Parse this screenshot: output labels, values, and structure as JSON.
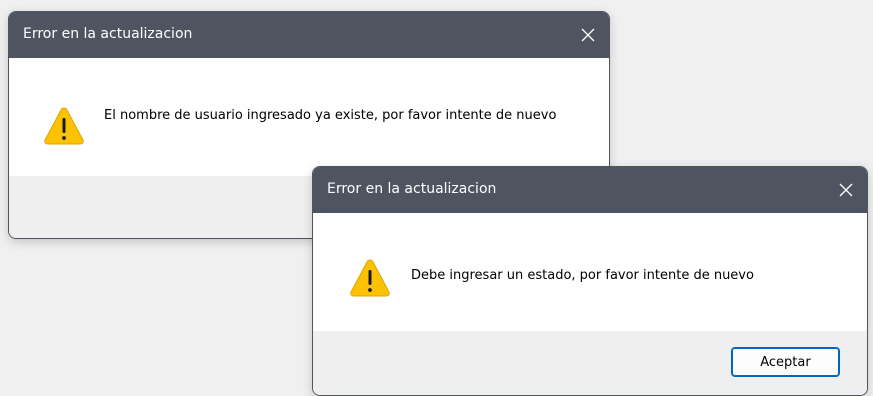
{
  "dialog_back": {
    "title": "Error en la actualizacion",
    "message": "El nombre de usuario ingresado ya existe, por favor intente de nuevo",
    "close_icon": "close-icon",
    "warning_icon": "warning-icon"
  },
  "dialog_front": {
    "title": "Error en la actualizacion",
    "message": "Debe ingresar un estado, por favor intente de nuevo",
    "close_icon": "close-icon",
    "warning_icon": "warning-icon",
    "ok_label": "Aceptar"
  },
  "colors": {
    "titlebar": "#4e5560",
    "background": "#f0f0f0",
    "footer": "#efefef",
    "warning_fill": "#fcc100",
    "accent": "#0067c0"
  }
}
